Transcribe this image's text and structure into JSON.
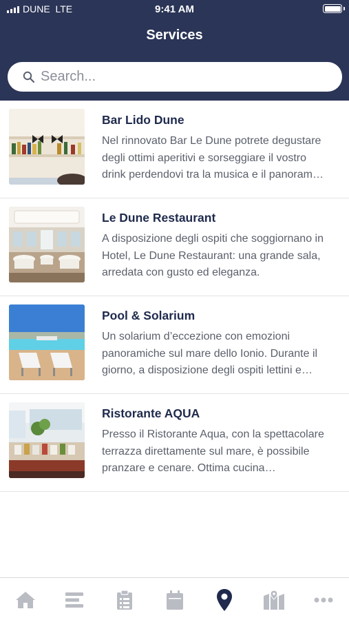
{
  "status_bar": {
    "carrier": "DUNE",
    "network": "LTE",
    "time": "9:41 AM"
  },
  "header": {
    "title": "Services"
  },
  "search": {
    "placeholder": "Search..."
  },
  "services": [
    {
      "title": "Bar Lido Dune",
      "description": "Nel rinnovato Bar Le Dune potrete degustare degli ottimi aperitivi e sorseggiare il vostro drink perdendovi tra la musica e il panorama del mare."
    },
    {
      "title": "Le Dune Restaurant",
      "description": "A disposizione degli ospiti che soggiornano in Hotel, Le Dune Restaurant: una grande sala, arredata con gusto ed eleganza."
    },
    {
      "title": "Pool & Solarium",
      "description": "Un solarium d’eccezione con emozioni panoramiche sul mare dello Ionio. Durante il giorno, a disposizione degli ospiti lettini e ombrelloni."
    },
    {
      "title": "Ristorante AQUA",
      "description": "Presso il Ristorante Aqua, con la spettacolare terrazza direttamente sul mare, è possibile pranzare e cenare. Ottima cucina mediterranea."
    }
  ],
  "tabbar": {
    "tabs": [
      "home-icon",
      "menu-icon",
      "clipboard-icon",
      "calendar-icon",
      "location-pin-icon",
      "map-icon",
      "more-icon"
    ],
    "active_index": 4
  },
  "colors": {
    "header": "#2b3557",
    "accent": "#1f2a4d",
    "inactive_icon": "#b9bcc3"
  }
}
